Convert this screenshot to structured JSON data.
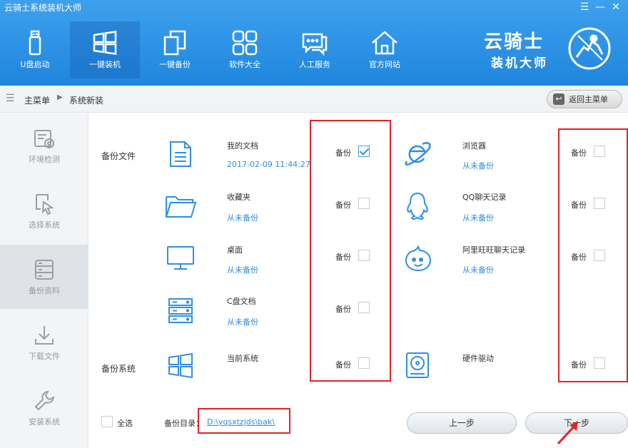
{
  "window": {
    "title": "云骑士系统装机大师",
    "menu_glyph": "☰",
    "minimize_glyph": "—",
    "close_glyph": "✕"
  },
  "nav": [
    {
      "label": "U盘启动",
      "icon": "usb-drive-icon"
    },
    {
      "label": "一键装机",
      "icon": "windows-icon",
      "active": true
    },
    {
      "label": "一键备份",
      "icon": "copy-icon"
    },
    {
      "label": "软件大全",
      "icon": "grid-apps-icon"
    },
    {
      "label": "人工服务",
      "icon": "chat-icon"
    },
    {
      "label": "官方网站",
      "icon": "home-icon"
    }
  ],
  "brand": {
    "name": "云骑士",
    "subtitle": "装机大师"
  },
  "breadcrumb": {
    "home": "主菜单",
    "separator": "▶",
    "current": "系统新装",
    "back_label": "返回主菜单",
    "back_glyph": "↩"
  },
  "sidebar": [
    {
      "label": "环境检测",
      "icon": "environment-check-icon"
    },
    {
      "label": "选择系统",
      "icon": "select-cursor-icon"
    },
    {
      "label": "备份资料",
      "icon": "backup-list-icon",
      "active": true
    },
    {
      "label": "下载文件",
      "icon": "download-icon"
    },
    {
      "label": "安装系统",
      "icon": "wrench-icon"
    }
  ],
  "backup_files": {
    "section_label": "备份文件",
    "left_items": [
      {
        "name": "我的文档",
        "status": "2017-02-09 11:44:27",
        "backup_label": "备份",
        "checked": true,
        "icon": "document-icon"
      },
      {
        "name": "收藏夹",
        "status": "从未备份",
        "backup_label": "备份",
        "checked": false,
        "icon": "folder-icon"
      },
      {
        "name": "桌面",
        "status": "从未备份",
        "backup_label": "备份",
        "checked": false,
        "icon": "monitor-icon"
      },
      {
        "name": "C盘文档",
        "status": "从未备份",
        "backup_label": "备份",
        "checked": false,
        "icon": "server-icon"
      }
    ],
    "right_items": [
      {
        "name": "浏览器",
        "status": "从未备份",
        "backup_label": "备份",
        "checked": false,
        "icon": "ie-browser-icon"
      },
      {
        "name": "QQ聊天记录",
        "status": "从未备份",
        "backup_label": "备份",
        "checked": false,
        "icon": "qq-penguin-icon"
      },
      {
        "name": "阿里旺旺聊天记录",
        "status": "从未备份",
        "backup_label": "备份",
        "checked": false,
        "icon": "wangwang-icon"
      }
    ]
  },
  "backup_system": {
    "section_label": "备份系统",
    "current_system": {
      "name": "当前系统",
      "backup_label": "备份",
      "checked": false,
      "icon": "windows-icon"
    },
    "driver": {
      "name": "硬件驱动",
      "backup_label": "备份",
      "checked": false,
      "icon": "hard-disk-icon"
    }
  },
  "footer": {
    "select_all_label": "全选",
    "dir_label": "备份目录：",
    "dir_path": "D:\\yqsxtzjds\\bak\\",
    "prev_label": "上一步",
    "next_label": "下一步"
  },
  "colors": {
    "header": "#2a93e6",
    "link": "#2e8ee0",
    "annotation_red": "#e0252b",
    "icon_blue": "#2f8fe3"
  }
}
